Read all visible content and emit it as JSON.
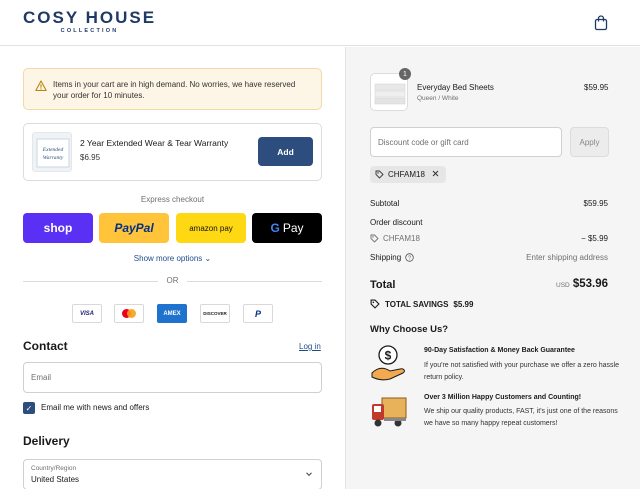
{
  "header": {
    "brand_main": "COSY HOUSE",
    "brand_sub": "COLLECTION"
  },
  "notice": {
    "text": "Items in your cart are in high demand. No worries, we have reserved your order for 10 minutes."
  },
  "upsell": {
    "title": "2 Year Extended Wear & Tear Warranty",
    "price": "$6.95",
    "image_text": "Extended Warranty",
    "add_label": "Add"
  },
  "express": {
    "label": "Express checkout",
    "shop_label": "shop",
    "paypal_label": "PayPal",
    "amazon_label": "amazon pay",
    "google_label": "Pay",
    "more_label": "Show more options",
    "or_label": "OR"
  },
  "cards": [
    "VISA",
    "",
    "AMEX",
    "DISCOVER",
    ""
  ],
  "contact": {
    "title": "Contact",
    "login_label": "Log in",
    "email_placeholder": "Email",
    "newsletter_label": "Email me with news and offers"
  },
  "delivery": {
    "title": "Delivery",
    "country_label": "Country/Region",
    "country_value": "United States"
  },
  "summary": {
    "item": {
      "name": "Everyday Bed Sheets",
      "variant": "Queen / White",
      "price": "$59.95",
      "quantity": "1"
    },
    "discount_placeholder": "Discount code or gift card",
    "apply_label": "Apply",
    "applied_code": "CHFAM18",
    "subtotal_label": "Subtotal",
    "subtotal_value": "$59.95",
    "order_discount_label": "Order discount",
    "discount_code": "CHFAM18",
    "discount_value": "− $5.99",
    "shipping_label": "Shipping",
    "shipping_value": "Enter shipping address",
    "total_label": "Total",
    "currency": "USD",
    "total_value": "$53.96",
    "savings_label": "TOTAL SAVINGS",
    "savings_value": "$5.99"
  },
  "why": {
    "title": "Why Choose Us?",
    "benefits": [
      {
        "title": "90-Day Satisfaction & Money Back Guarantee",
        "text": "If you're not satisfied with your purchase we offer a zero hassle return policy."
      },
      {
        "title": "Over 3 Million Happy Customers and Counting!",
        "text": "We ship our quality products, FAST, it's just one of the reasons we have so many happy repeat customers!"
      }
    ]
  },
  "colors": {
    "brand": "#1f3a66",
    "primary_button": "#2d4d7e",
    "link": "#1f4e8c",
    "notice_bg": "#fdf5e6",
    "shop_pay": "#5a31f4",
    "paypal": "#ffc439",
    "amazon_pay": "#ffd814",
    "google_pay": "#000000"
  }
}
